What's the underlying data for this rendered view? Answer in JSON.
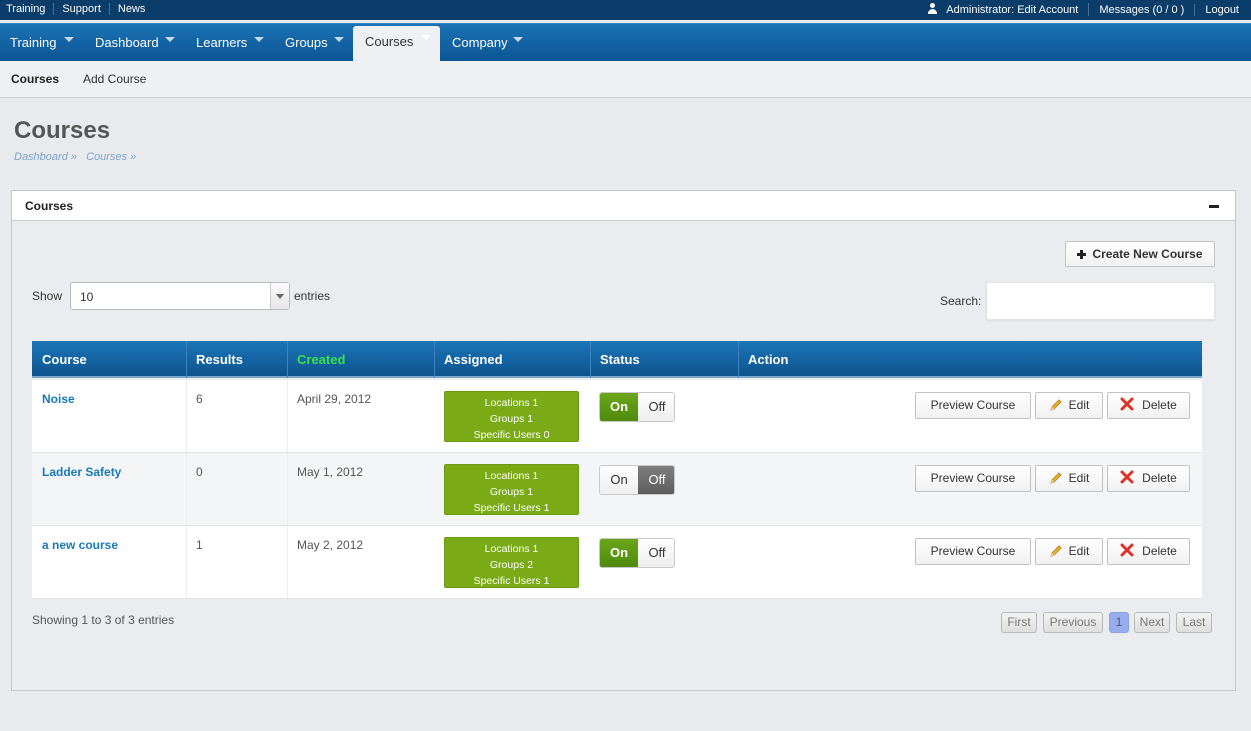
{
  "topbar": {
    "links": [
      "Training",
      "Support",
      "News"
    ],
    "account": "Administrator: Edit Account",
    "messages": "Messages (0 / 0 )",
    "logout": "Logout"
  },
  "mainnav": {
    "tabs": [
      "Training",
      "Dashboard",
      "Learners",
      "Groups",
      "Courses",
      "Company"
    ],
    "active": "Courses"
  },
  "subnav": {
    "items": [
      "Courses",
      "Add Course"
    ],
    "active": "Courses"
  },
  "page": {
    "title": "Courses",
    "breadcrumb": [
      "Dashboard »",
      "Courses »"
    ]
  },
  "panel": {
    "title": "Courses",
    "create_label": "Create New Course",
    "show_label": "Show",
    "entries_select": "10",
    "entries_label": "entries",
    "search_label": "Search:",
    "search_value": ""
  },
  "table": {
    "headers": [
      "Course",
      "Results",
      "Created",
      "Assigned",
      "Status",
      "Action"
    ],
    "sorted_column": "Created",
    "rows": [
      {
        "course": "Noise",
        "results": "6",
        "created": "April 29, 2012",
        "assigned": [
          "Locations 1",
          "Groups 1",
          "Specific Users 0"
        ],
        "status": "on"
      },
      {
        "course": "Ladder Safety",
        "results": "0",
        "created": "May 1, 2012",
        "assigned": [
          "Locations 1",
          "Groups 1",
          "Specific Users 1"
        ],
        "status": "off"
      },
      {
        "course": "a new course",
        "results": "1",
        "created": "May 2, 2012",
        "assigned": [
          "Locations 1",
          "Groups 2",
          "Specific Users 1"
        ],
        "status": "on"
      }
    ],
    "toggle_on": "On",
    "toggle_off": "Off",
    "actions": {
      "preview": "Preview Course",
      "edit": "Edit",
      "delete": "Delete"
    }
  },
  "footer": {
    "info": "Showing 1 to 3 of 3 entries",
    "pager": [
      "First",
      "Previous",
      "1",
      "Next",
      "Last"
    ],
    "current_page": "1"
  },
  "colors": {
    "topbar": "#0b3d6b",
    "nav": "#1b72b4",
    "assigned_green": "#7aab16",
    "toggle_on_green": "#5a9612",
    "toggle_off_gray": "#6e6e6e",
    "sorted_header": "#38e04a",
    "link_blue": "#1a7ab8"
  }
}
